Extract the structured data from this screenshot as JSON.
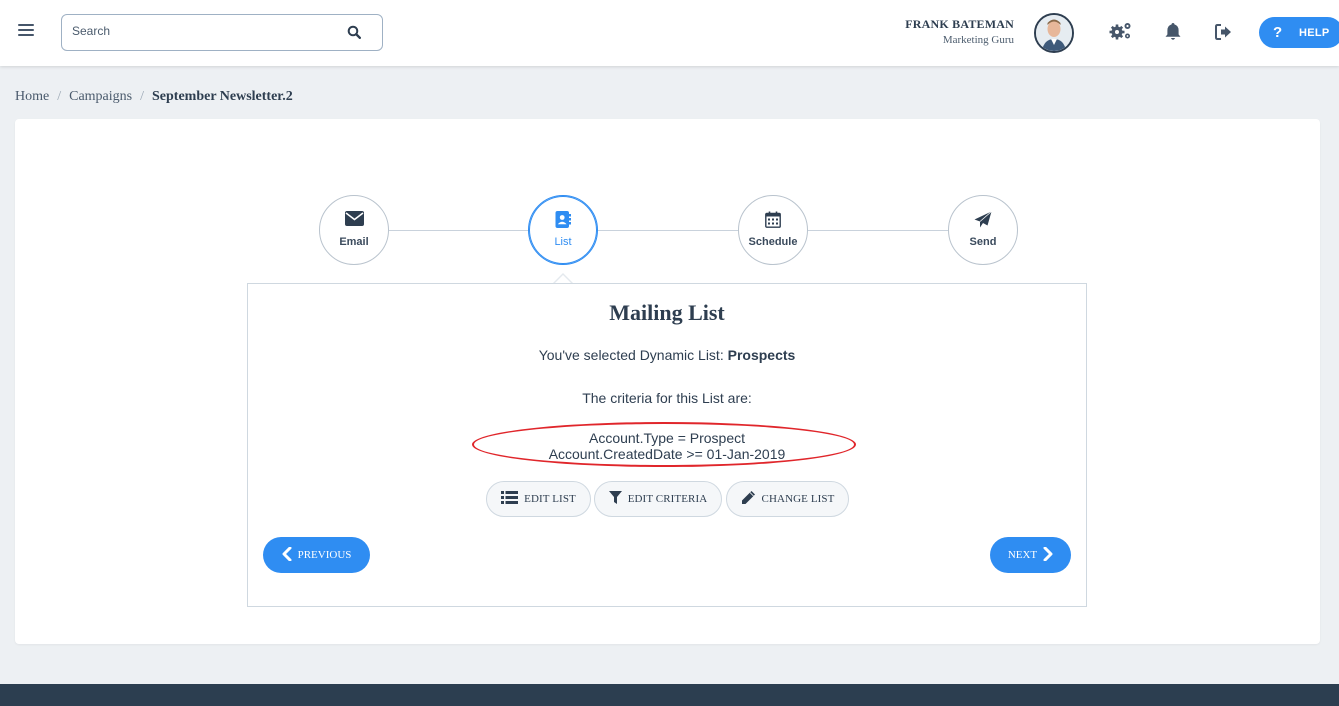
{
  "topbar": {
    "search_placeholder": "Search",
    "user_name": "FRANK BATEMAN",
    "user_role": "Marketing Guru",
    "help_label": "HELP",
    "icons": [
      "menu-icon",
      "search-icon",
      "settings-icon",
      "bell-icon",
      "logout-icon",
      "question-icon"
    ]
  },
  "breadcrumb": {
    "home": "Home",
    "campaigns": "Campaigns",
    "current": "September Newsletter.2"
  },
  "steps": [
    {
      "label": "Email",
      "icon": "envelope-icon",
      "active": false
    },
    {
      "label": "List",
      "icon": "contact-book-icon",
      "active": true
    },
    {
      "label": "Schedule",
      "icon": "calendar-icon",
      "active": false
    },
    {
      "label": "Send",
      "icon": "paper-plane-icon",
      "active": false
    }
  ],
  "panel": {
    "title": "Mailing List",
    "selected_prefix": "You've selected Dynamic List: ",
    "selected_list": "Prospects",
    "criteria_label": "The criteria for this List are:",
    "criteria": [
      "Account.Type = Prospect",
      "Account.CreatedDate >= 01-Jan-2019"
    ],
    "actions": {
      "edit_list": "EDIT LIST",
      "edit_criteria": "EDIT CRITERIA",
      "change_list": "CHANGE LIST"
    },
    "previous_label": "PREVIOUS",
    "next_label": "NEXT"
  },
  "colors": {
    "accent": "#2f8df2",
    "highlight_ellipse": "#e0262b",
    "footer": "#2c3e50"
  }
}
